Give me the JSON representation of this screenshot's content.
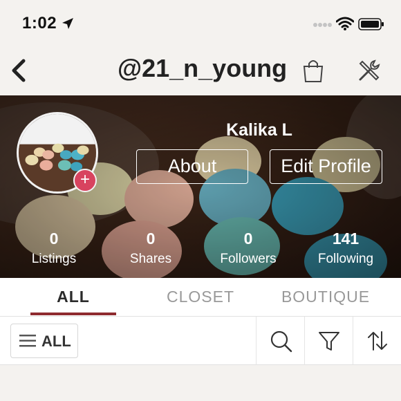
{
  "status_bar": {
    "time": "1:02",
    "icons": [
      "location-arrow-icon",
      "signal-dots-icon",
      "wifi-icon",
      "battery-icon"
    ]
  },
  "nav": {
    "title": "@21_n_young",
    "icons": [
      "back-chevron-icon",
      "shopping-bag-icon",
      "tools-icon"
    ]
  },
  "profile": {
    "name": "Kalika L",
    "about_label": "About",
    "edit_label": "Edit Profile",
    "add_photo_glyph": "+"
  },
  "stats": [
    {
      "value": "0",
      "label": "Listings"
    },
    {
      "value": "0",
      "label": "Shares"
    },
    {
      "value": "0",
      "label": "Followers"
    },
    {
      "value": "141",
      "label": "Following"
    }
  ],
  "tabs": {
    "all": "ALL",
    "closet": "CLOSET",
    "boutique": "BOUTIQUE",
    "active": "ALL"
  },
  "filter": {
    "all_label": "ALL",
    "icons": [
      "menu-icon",
      "search-icon",
      "filter-funnel-icon",
      "sort-arrows-icon"
    ]
  },
  "colors": {
    "background": "#f4f2ef",
    "accent": "#8e2b2f",
    "add_badge": "#d8435f"
  }
}
